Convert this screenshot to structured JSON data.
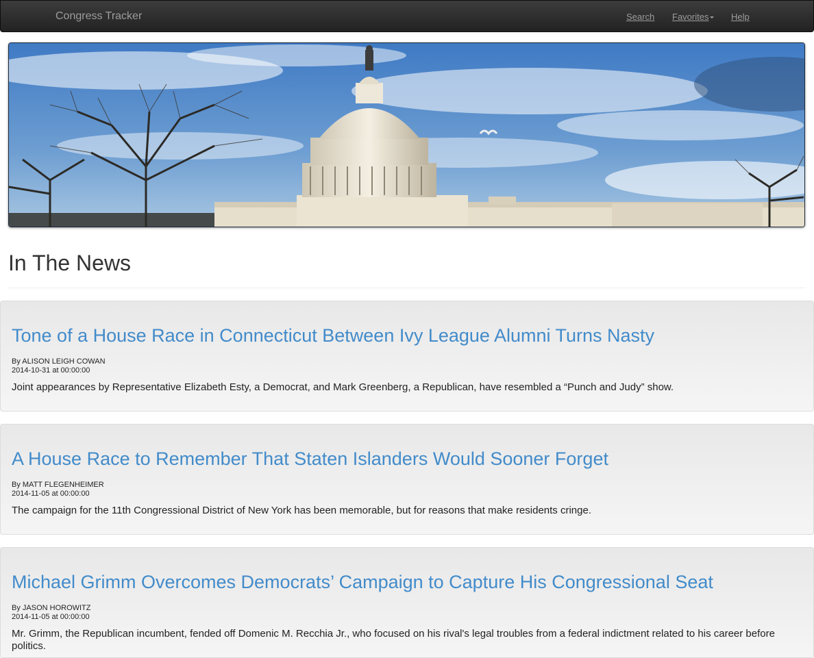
{
  "navbar": {
    "brand": "Congress Tracker",
    "links": {
      "search": "Search",
      "favorites": "Favorites",
      "help": "Help"
    }
  },
  "banner": {
    "icon": "capitol-building-photo",
    "colors": {
      "sky_top": "#3f7ac4",
      "sky_bottom": "#9cc0de",
      "building": "#ece6d6"
    }
  },
  "section": {
    "title": "In The News"
  },
  "articles": [
    {
      "headline": "Tone of a House Race in Connecticut Between Ivy League Alumni Turns Nasty",
      "byline": "By ALISON LEIGH COWAN",
      "date": "2014-10-31 at 00:00:00",
      "summary": "Joint appearances by Representative Elizabeth Esty, a Democrat, and Mark Greenberg, a Republican, have resembled a “Punch and Judy” show."
    },
    {
      "headline": "A House Race to Remember That Staten Islanders Would Sooner Forget",
      "byline": "By MATT FLEGENHEIMER",
      "date": "2014-11-05 at 00:00:00",
      "summary": "The campaign for the 11th Congressional District of New York has been memorable, but for reasons that make residents cringe."
    },
    {
      "headline": "Michael Grimm Overcomes Democrats’ Campaign to Capture His Congressional Seat",
      "byline": "By JASON HOROWITZ",
      "date": "2014-11-05 at 00:00:00",
      "summary": "Mr. Grimm, the Republican incumbent, fended off Domenic M. Recchia Jr., who focused on his rival's legal troubles from a federal indictment related to his career before politics."
    }
  ],
  "colors": {
    "link": "#428bca",
    "navbar_bg": "#2a2a2a",
    "card_bg": "#eeeeee"
  }
}
